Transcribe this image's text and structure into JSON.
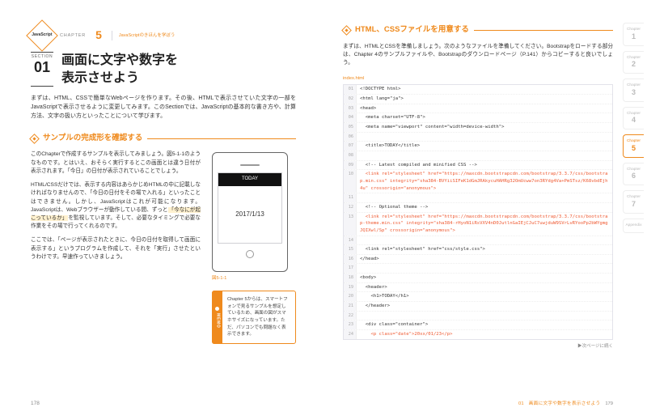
{
  "chapter": {
    "label": "CHAPTER",
    "number": "5",
    "subtitle": "JavaScriptのきほんを学ぼう",
    "chip": "JavaScript"
  },
  "section": {
    "label": "SECTION",
    "number": "01"
  },
  "title": "画面に文字や数字を\n表示させよう",
  "intro": "まずは、HTML、CSSで簡単なWebページを作ります。その後、HTMLで表示させていた文字の一部をJavaScriptで表示させるように変更してみます。このSectionでは、JavaScriptの基本的な書き方や、計算方法、文字の扱い方といったことについて学びます。",
  "sec1": {
    "heading": "サンプルの完成形を確認する",
    "p1": "このChapterで作成するサンプルを表示してみましょう。図5-1-1のようなものです。とはいえ、おそらく実行するとこの画面とは違う日付が表示されます。「今日」の日付が表示されていることでしょう。",
    "p2a": "HTML/CSSだけでは、表示する内容はあらかじめHTMLの中に記載しなければなりませんので、「今日の日付をその場で入れる」といったことはできません。しかし、JavaScriptはこれが可能になります。JavaScriptは、Webブラウザーが動作している間、ずっと",
    "p2hl": "「今なにが起こっているか」",
    "p2b": "を監視しています。そして、必要なタイミングで必要な作業をその場で行ってくれるのです。",
    "p3": "ここでは、「ページが表示されたときに、今日の日付を取得して画面に表示する」というプログラムを作成して、それを「実行」させたというわけです。早速作っていきましょう。",
    "phone": {
      "head": "TODAY",
      "date": "2017/1/13"
    },
    "figcap": "図5-1-1",
    "memo_label": "MEMO",
    "memo": "Chapter 5からは、スマートフォンで見るサンプルを想定しているため、画面の図がスマホサイズになっています。ただ、パソコンでも問題なく表示できます。"
  },
  "right": {
    "heading": "HTML、CSSファイルを用意する",
    "intro": "まずは、HTMLとCSSを準備しましょう。次のようなファイルを準備してください。Bootstrapをロードする部分は、Chapter 4のサンプルファイルや、Bootstrapのダウンロードページ（P.141）からコピーすると良いでしょう。",
    "file": "index.html",
    "code": [
      {
        "n": "01",
        "t": "<!DOCTYPE html>"
      },
      {
        "n": "02",
        "t": "<html lang=\"ja\">"
      },
      {
        "n": "03",
        "t": "<head>"
      },
      {
        "n": "04",
        "t": "  <meta charset=\"UTF-8\">"
      },
      {
        "n": "05",
        "t": "  <meta name=\"viewport\" content=\"width=device-width\">"
      },
      {
        "n": "06",
        "t": ""
      },
      {
        "n": "07",
        "t": "  <title>TODAY</title>"
      },
      {
        "n": "08",
        "t": ""
      },
      {
        "n": "09",
        "t": "  <!-- Latest compiled and minified CSS -->"
      },
      {
        "n": "10",
        "t": "  <link rel=\"stylesheet\" href=\"https://maxcdn.bootstrapcdn.com/bootstrap/3.3.7/css/bootstrap.min.css\" integrity=\"sha384-BVYiiSIFeK1dGmJRAkycuHAHRg32OmUcww7on3RYdg4Va+PmSTsz/K68vbdEjh4u\" crossorigin=\"anonymous\">",
        "hl": true
      },
      {
        "n": "11",
        "t": ""
      },
      {
        "n": "12",
        "t": "  <!-- Optional theme -->"
      },
      {
        "n": "13",
        "t": "  <link rel=\"stylesheet\" href=\"https://maxcdn.bootstrapcdn.com/bootstrap/3.3.7/css/bootstrap-theme.min.css\" integrity=\"sha384-rHyoN1iRsVXV4nD0JutlnGaIEjCJuC7uwjduW9SVrLvRYooPp2bWYgmgJQIXwl/Sp\" crossorigin=\"anonymous\">",
        "hl": true
      },
      {
        "n": "14",
        "t": ""
      },
      {
        "n": "15",
        "t": "  <link rel=\"stylesheet\" href=\"css/style.css\">"
      },
      {
        "n": "16",
        "t": "</head>"
      },
      {
        "n": "17",
        "t": ""
      },
      {
        "n": "18",
        "t": "<body>"
      },
      {
        "n": "19",
        "t": "  <header>"
      },
      {
        "n": "20",
        "t": "    <h1>TODAY</h1>"
      },
      {
        "n": "21",
        "t": "  </header>"
      },
      {
        "n": "22",
        "t": ""
      },
      {
        "n": "23",
        "t": "  <div class=\"container\">"
      },
      {
        "n": "24",
        "t": "    <p class=\"date\">20xx/01/23</p>",
        "hl": true
      }
    ],
    "turn": "▶次ページに続く"
  },
  "tabs": [
    {
      "label": "Chapter",
      "n": "1"
    },
    {
      "label": "Chapter",
      "n": "2"
    },
    {
      "label": "Chapter",
      "n": "3"
    },
    {
      "label": "Chapter",
      "n": "4"
    },
    {
      "label": "Chapter",
      "n": "5",
      "active": true
    },
    {
      "label": "Chapter",
      "n": "6"
    },
    {
      "label": "Chapter",
      "n": "7"
    },
    {
      "label": "Appendix",
      "n": ""
    }
  ],
  "folio": {
    "left": "178",
    "right": "179",
    "right_label": "01　画面に文字や数字を表示させよう"
  }
}
